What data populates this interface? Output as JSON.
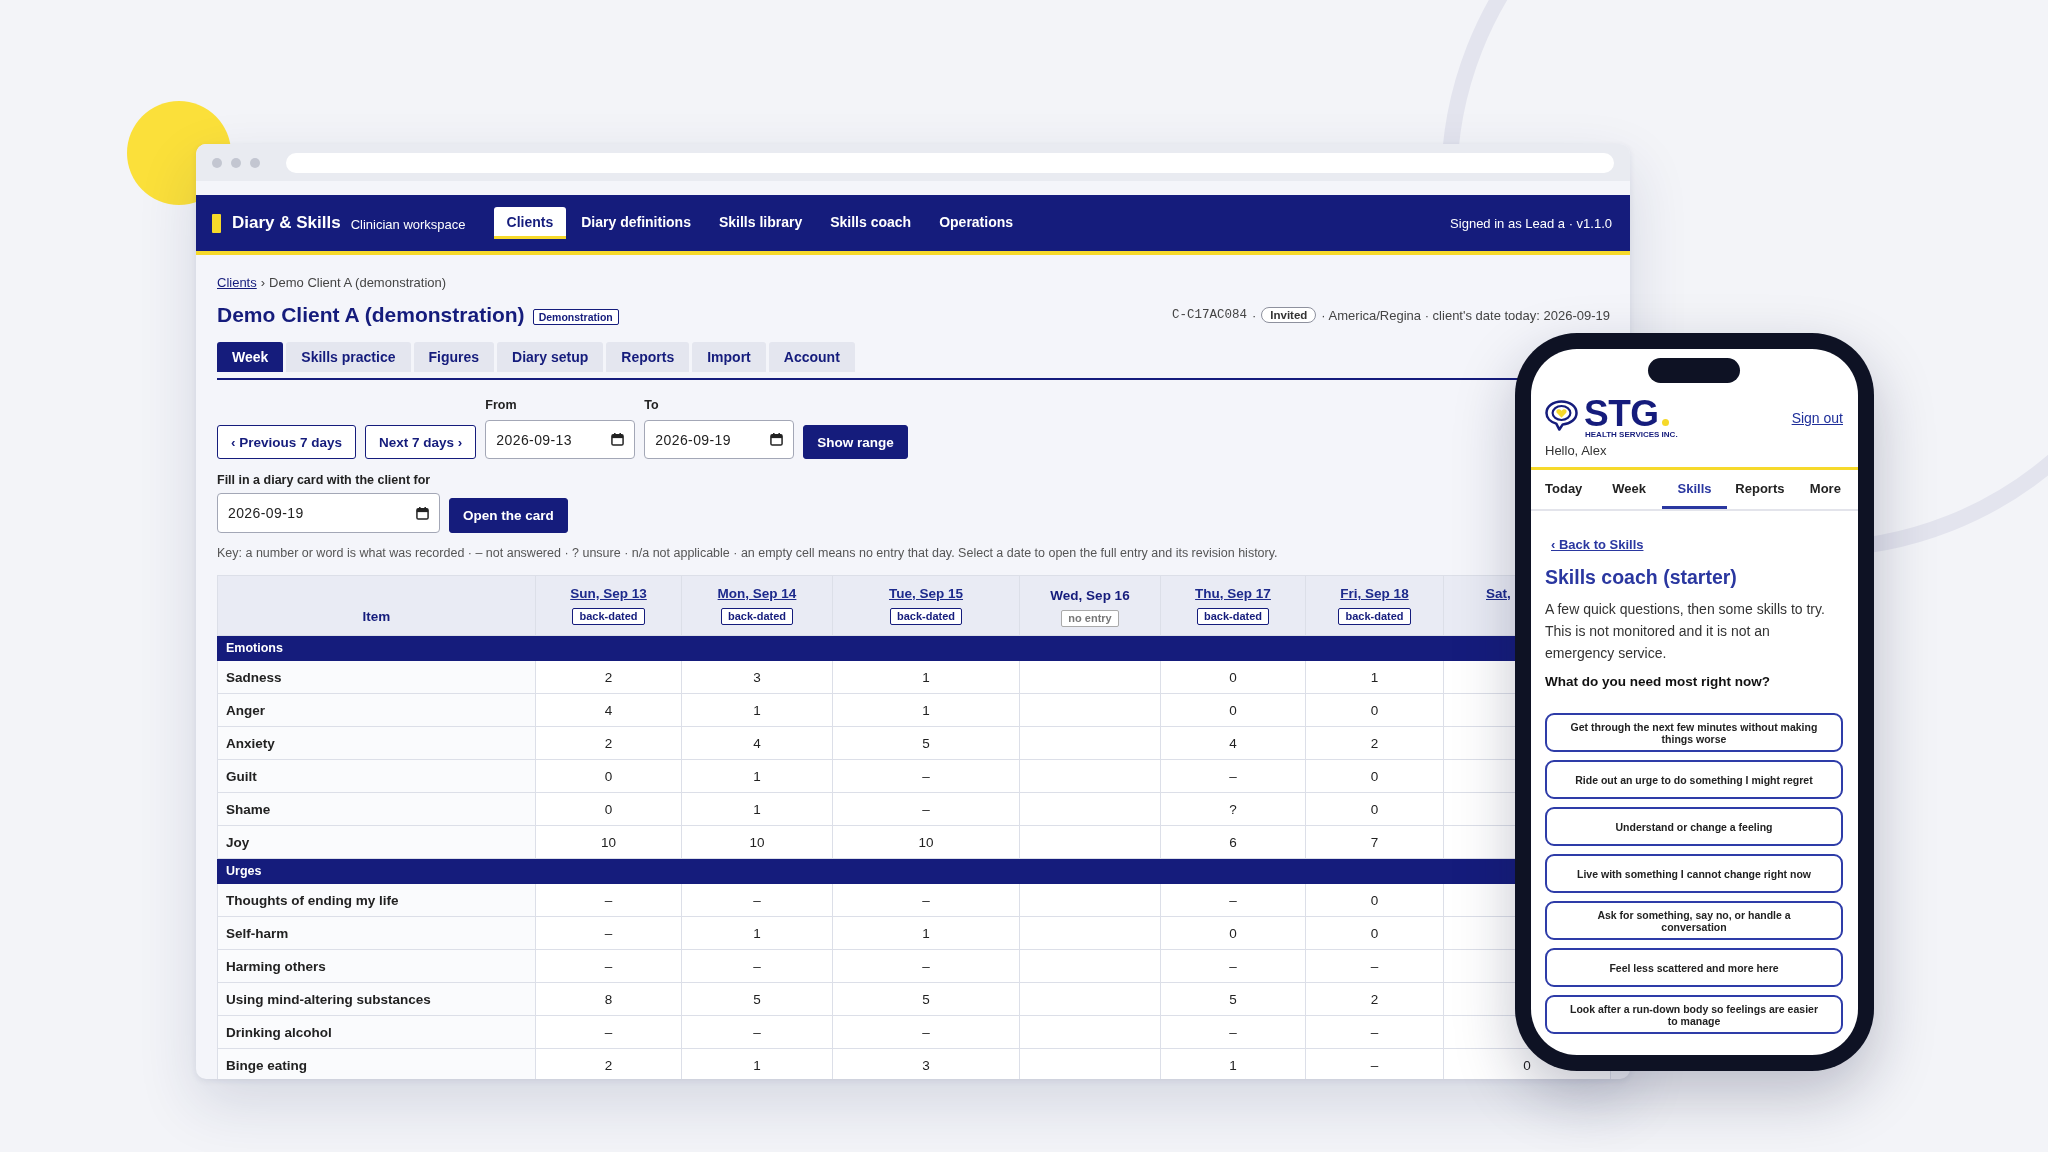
{
  "browser": {
    "app_bar": {
      "brand": "Diary & Skills",
      "subtitle": "Clinician workspace",
      "nav": [
        {
          "label": "Clients",
          "selected": true
        },
        {
          "label": "Diary definitions",
          "selected": false
        },
        {
          "label": "Skills library",
          "selected": false
        },
        {
          "label": "Skills coach",
          "selected": false
        },
        {
          "label": "Operations",
          "selected": false
        }
      ],
      "signed_in": "Signed in as Lead a · v1.1.0"
    },
    "breadcrumb": {
      "items": [
        {
          "label": "Clients",
          "link": true
        },
        {
          "label": "Demo Client A (demonstration)",
          "link": false
        }
      ],
      "separator": "›"
    },
    "client": {
      "name": "Demo Client A (demonstration)",
      "badge": "Demonstration",
      "meta": [
        {
          "kind": "code",
          "text": "C-C17AC084"
        },
        {
          "kind": "text",
          "text": "·"
        },
        {
          "kind": "pill",
          "text": "Invited"
        },
        {
          "kind": "text",
          "text": "· America/Regina · client's date today: 2026-09-19"
        }
      ]
    },
    "tabs": [
      {
        "label": "Week",
        "selected": true
      },
      {
        "label": "Skills practice",
        "selected": false
      },
      {
        "label": "Figures",
        "selected": false
      },
      {
        "label": "Diary setup",
        "selected": false
      },
      {
        "label": "Reports",
        "selected": false
      },
      {
        "label": "Import",
        "selected": false
      },
      {
        "label": "Account",
        "selected": false
      }
    ],
    "range": {
      "previous": "‹ Previous 7 days",
      "next": "Next 7 days ›",
      "from": {
        "label": "From",
        "value": "2026-09-13"
      },
      "to": {
        "label": "To",
        "value": "2026-09-19"
      },
      "show": "Show range"
    },
    "fill_in": {
      "label": "Fill in a diary card with the client for",
      "value": "2026-09-19",
      "button": "Open the card"
    },
    "key": "Key: a number or word is what was recorded · – not answered · ? unsure · n/a not applicable · an empty cell means no entry that day. Select a date to open the full entry and its revision history.",
    "table": {
      "item_heading": "Item",
      "days": [
        {
          "label": "Sun, Sep 13",
          "link": true,
          "badge": {
            "text": "back-dated",
            "kind": "dated"
          }
        },
        {
          "label": "Mon, Sep 14",
          "link": true,
          "badge": {
            "text": "back-dated",
            "kind": "dated"
          }
        },
        {
          "label": "Tue, Sep 15",
          "link": true,
          "badge": {
            "text": "back-dated",
            "kind": "dated"
          }
        },
        {
          "label": "Wed, Sep 16",
          "link": false,
          "badge": {
            "text": "no entry",
            "kind": "empty"
          }
        },
        {
          "label": "Thu, Sep 17",
          "link": true,
          "badge": {
            "text": "back-dated",
            "kind": "dated"
          }
        },
        {
          "label": "Fri, Sep 18",
          "link": true,
          "badge": {
            "text": "back-dated",
            "kind": "dated"
          }
        },
        {
          "label": "Sat,",
          "link": true
        }
      ],
      "sections": [
        {
          "name": "Emotions",
          "rows": [
            {
              "item": "Sadness",
              "values": [
                "2",
                "3",
                "1",
                "0",
                "1"
              ]
            },
            {
              "item": "Anger",
              "values": [
                "4",
                "1",
                "1",
                "0",
                "0"
              ]
            },
            {
              "item": "Anxiety",
              "values": [
                "2",
                "4",
                "5",
                "4",
                "2"
              ]
            },
            {
              "item": "Guilt",
              "values": [
                "0",
                "1",
                "–",
                "–",
                "0"
              ]
            },
            {
              "item": "Shame",
              "values": [
                "0",
                "1",
                "–",
                "?",
                "0"
              ]
            },
            {
              "item": "Joy",
              "values": [
                "10",
                "10",
                "10",
                "6",
                "7"
              ]
            }
          ]
        },
        {
          "name": "Urges",
          "rows": [
            {
              "item": "Thoughts of ending my life",
              "values": [
                "–",
                "–",
                "–",
                "–",
                "0"
              ]
            },
            {
              "item": "Self-harm",
              "values": [
                "–",
                "1",
                "1",
                "0",
                "0"
              ]
            },
            {
              "item": "Harming others",
              "values": [
                "–",
                "–",
                "–",
                "–",
                "–"
              ]
            },
            {
              "item": "Using mind-altering substances",
              "values": [
                "8",
                "5",
                "5",
                "5",
                "2"
              ]
            },
            {
              "item": "Drinking alcohol",
              "values": [
                "–",
                "–",
                "–",
                "–",
                "–"
              ]
            },
            {
              "item": "Binge eating",
              "values": [
                "2",
                "1",
                "3",
                "1",
                "–",
                "0"
              ]
            }
          ]
        }
      ]
    }
  },
  "phone": {
    "brand": {
      "name": "STG",
      "tagline": "HEALTH SERVICES INC."
    },
    "sign_out": "Sign out",
    "greeting": "Hello, Alex",
    "tabs": [
      {
        "label": "Today",
        "selected": false
      },
      {
        "label": "Week",
        "selected": false
      },
      {
        "label": "Skills",
        "selected": true
      },
      {
        "label": "Reports",
        "selected": false
      },
      {
        "label": "More",
        "selected": false
      }
    ],
    "back": "‹ Back to Skills",
    "title": "Skills coach (starter)",
    "intro": "A few quick questions, then some skills to try. This is not monitored and it is not an emergency service.",
    "question": "What do you need most right now?",
    "options": [
      "Get through the next few minutes without making things worse",
      "Ride out an urge to do something I might regret",
      "Understand or change a feeling",
      "Live with something I cannot change right now",
      "Ask for something, say no, or handle a conversation",
      "Feel less scattered and more here",
      "Look after a run-down body so feelings are easier to manage"
    ]
  }
}
